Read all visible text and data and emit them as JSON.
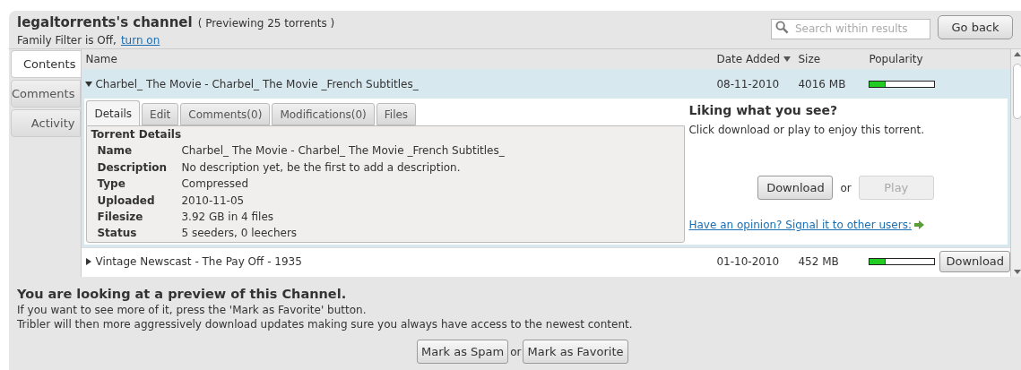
{
  "header": {
    "title": "legaltorrents's channel",
    "subtitle": "( Previewing 25 torrents )",
    "filter_text": "Family Filter is Off,",
    "filter_link": "turn on",
    "search": {
      "placeholder": "Search within results"
    },
    "back_button": "Go back"
  },
  "side_tabs": [
    {
      "label": "Contents",
      "selected": true
    },
    {
      "label": "Comments",
      "selected": false
    },
    {
      "label": "Activity",
      "selected": false
    }
  ],
  "columns": [
    {
      "label": "Name",
      "sorted": false
    },
    {
      "label": "Date Added",
      "sorted": true
    },
    {
      "label": "Size",
      "sorted": false
    },
    {
      "label": "Popularity",
      "sorted": false
    }
  ],
  "rows": [
    {
      "name": "Charbel_ The Movie - Charbel_ The Movie _French Subtitles_",
      "date": "08-11-2010",
      "size": "4016 MB",
      "level": 0.25,
      "expanded": true,
      "selected": true
    },
    {
      "name": "Vintage Newscast - The Pay Off - 1935",
      "date": "01-10-2010",
      "size": "452 MB",
      "level": 0.25,
      "expanded": false,
      "selected": false,
      "button": "Download"
    }
  ],
  "detail": {
    "tabs": [
      {
        "label": "Details",
        "selected": true
      },
      {
        "label": "Edit",
        "selected": false
      },
      {
        "label": "Comments(0)",
        "selected": false
      },
      {
        "label": "Modifications(0)",
        "selected": false
      },
      {
        "label": "Files",
        "selected": false
      }
    ],
    "section_title": "Torrent Details",
    "fields": [
      {
        "label": "Name",
        "value": "Charbel_ The Movie - Charbel_ The Movie _French Subtitles_"
      },
      {
        "label": "Description",
        "value": "No description yet, be the first to add a description."
      },
      {
        "label": "Type",
        "value": "Compressed"
      },
      {
        "label": "Uploaded",
        "value": "2010-11-05"
      },
      {
        "label": "Filesize",
        "value": "3.92 GB in 4 files"
      },
      {
        "label": "Status",
        "value": "5 seeders, 0 leechers"
      }
    ],
    "aside": {
      "title": "Liking what you see?",
      "text": "Click download or play to enjoy this torrent.",
      "download": {
        "label": "Download",
        "disabled": false
      },
      "or": "or",
      "play": {
        "label": "Play",
        "disabled": true
      },
      "link": "Have an opinion? Signal it to other users:"
    }
  },
  "footer": {
    "title": "You are looking at a preview of this Channel.",
    "lines": [
      "If you want to see more of it, press the 'Mark as Favorite' button.",
      "Tribler will then more aggressively download updates making sure you always have access to the newest content."
    ],
    "spam_button": "Mark as Spam",
    "or": "or",
    "favorite_button": "Mark as Favorite"
  }
}
